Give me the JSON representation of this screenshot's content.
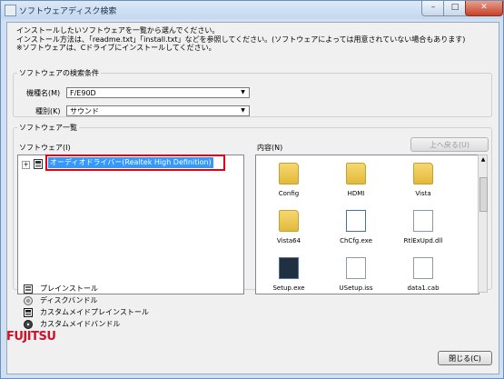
{
  "window": {
    "title": "ソフトウェアディスク検索"
  },
  "intro": {
    "line1": "インストールしたいソフトウェアを一覧から選んでください。",
    "line2": "インストール方法は、「readme.txt」「install.txt」などを参照してください。(ソフトウェアによっては用意されていない場合もあります)",
    "line3": "※ソフトウェアは、Cドライブにインストールしてください。"
  },
  "search": {
    "group_label": "ソフトウェアの検索条件",
    "model_label": "機種名(M)",
    "model_value": "F/E90D",
    "type_label": "種別(K)",
    "type_value": "サウンド"
  },
  "list": {
    "group_label": "ソフトウェア一覧",
    "software_label": "ソフトウェア(I)",
    "content_label": "内容(N)",
    "up_button": "上へ戻る(U)",
    "selected_item": "オーディオドライバー(Realtek High Definition)",
    "files": [
      {
        "name": "Config",
        "kind": "folder"
      },
      {
        "name": "HDMI",
        "kind": "folder"
      },
      {
        "name": "Vista",
        "kind": "folder"
      },
      {
        "name": "Vista64",
        "kind": "folder"
      },
      {
        "name": "ChCfg.exe",
        "kind": "exe"
      },
      {
        "name": "RtlExUpd.dll",
        "kind": "dll"
      },
      {
        "name": "Setup.exe",
        "kind": "setup"
      },
      {
        "name": "USetup.iss",
        "kind": "file"
      },
      {
        "name": "data1.cab",
        "kind": "file"
      }
    ]
  },
  "legend": [
    {
      "label": "プレインストール",
      "icon": "preinstall-icon"
    },
    {
      "label": "ディスクバンドル",
      "icon": "disk-bundle-icon"
    },
    {
      "label": "カスタムメイドプレインストール",
      "icon": "custom-preinstall-icon"
    },
    {
      "label": "カスタムメイドバンドル",
      "icon": "custom-bundle-icon"
    }
  ],
  "footer": {
    "logo": "FUJITSU",
    "close_button": "閉じる(C)"
  }
}
